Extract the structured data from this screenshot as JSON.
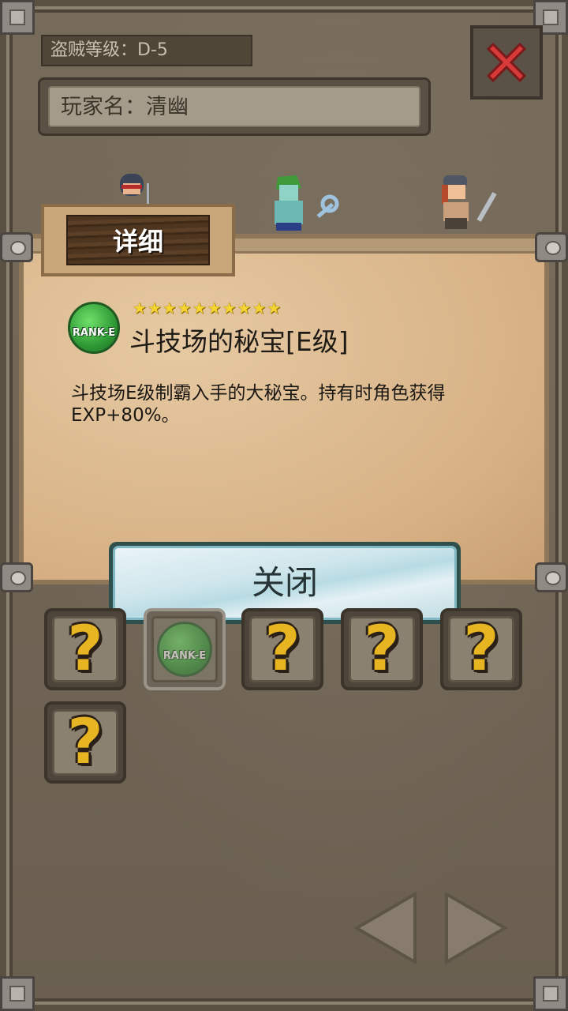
{
  "header": {
    "rank_label": "盗贼等级：D-5",
    "player_name": "玩家名：清幽"
  },
  "characters": [
    "hooded-warrior",
    "green-ghost-mage",
    "bandana-swordsman"
  ],
  "detail": {
    "title": "详细",
    "item": {
      "badge_text": "RANK-E",
      "stars": "★★★★★★★★★★",
      "name": "斗技场的秘宝[E级]",
      "description": "斗技场E级制霸入手的大秘宝。持有时角色获得EXP+80%。"
    },
    "close_label": "关闭"
  },
  "collection": {
    "slots": [
      {
        "type": "unknown",
        "label": "?"
      },
      {
        "type": "item",
        "label": "RANK-E"
      },
      {
        "type": "unknown",
        "label": "?"
      },
      {
        "type": "unknown",
        "label": "?"
      },
      {
        "type": "unknown",
        "label": "?"
      },
      {
        "type": "unknown",
        "label": "?"
      }
    ]
  },
  "icons": {
    "close": "close-x-icon",
    "prev": "arrow-left-icon",
    "next": "arrow-right-icon"
  },
  "colors": {
    "background": "#6e6354",
    "parchment": "#d7b185",
    "close_x": "#d83a3a",
    "badge_green": "#2f9a35",
    "star": "#f6d431",
    "question_mark": "#e7b522",
    "button_ice": "#cfe6ec"
  }
}
